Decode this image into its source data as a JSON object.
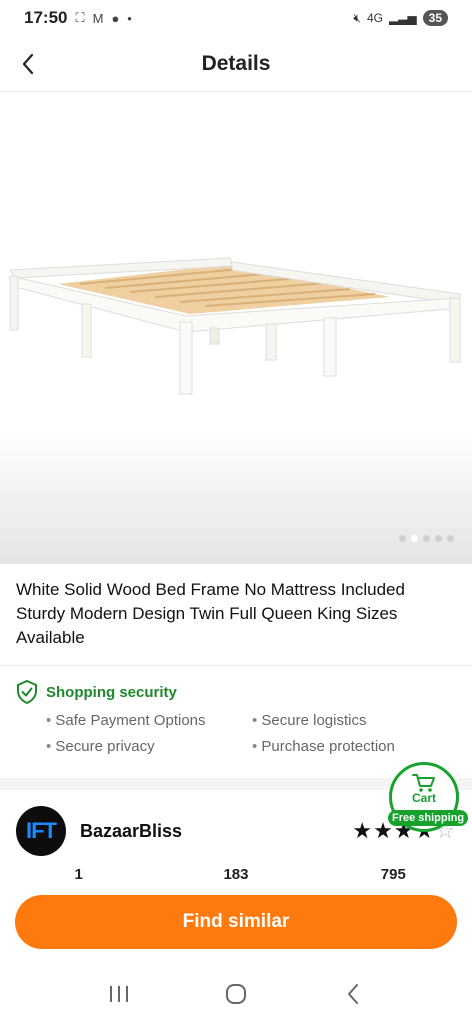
{
  "status_bar": {
    "time": "17:50",
    "network": "4G",
    "battery": "35",
    "icons": [
      "screenshot-icon",
      "gmail-icon",
      "chat-icon",
      "mute-icon",
      "signal-icon"
    ]
  },
  "header": {
    "title": "Details",
    "back_icon": "chevron-left-icon"
  },
  "gallery": {
    "image_alt": "white wooden bed frame with slats",
    "dot_count": 5,
    "active_dot": 1
  },
  "product": {
    "title": "White Solid Wood Bed Frame No Mattress Included Sturdy Modern Design Twin Full Queen King Sizes Available"
  },
  "security": {
    "title": "Shopping security",
    "items": [
      "Safe Payment Options",
      "Secure logistics",
      "Secure privacy",
      "Purchase protection"
    ]
  },
  "seller": {
    "avatar_text": "IFT",
    "name": "BazaarBliss",
    "rating_stars": 4,
    "rating_max": 5,
    "stats": [
      "1",
      "183",
      "795"
    ]
  },
  "cart": {
    "label": "Cart",
    "badge": "Free shipping"
  },
  "actions": {
    "find_similar": "Find similar"
  },
  "colors": {
    "accent_orange": "#ff7a0e",
    "security_green": "#1f8a2c",
    "cart_green": "#16a22c"
  }
}
